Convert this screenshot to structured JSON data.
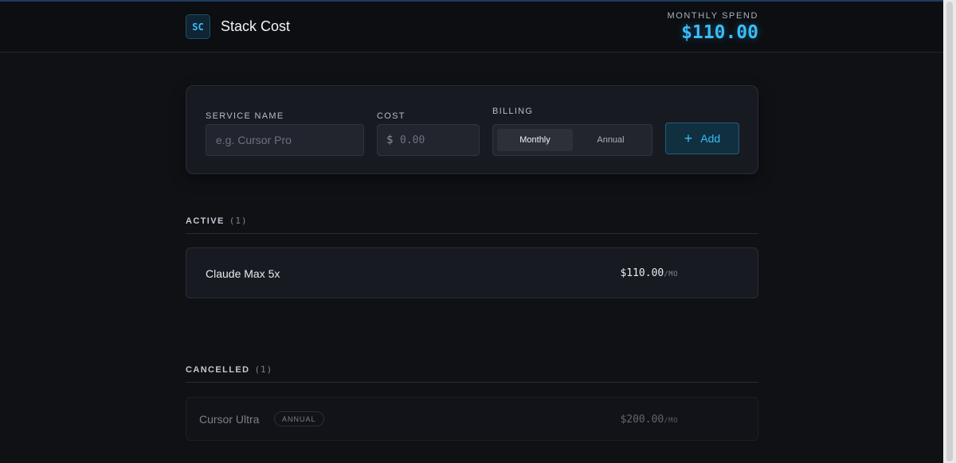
{
  "header": {
    "logo_text": "SC",
    "app_title": "Stack Cost",
    "spend_label": "MONTHLY SPEND",
    "spend_value": "$110.00"
  },
  "form": {
    "service_label": "SERVICE NAME",
    "service_placeholder": "e.g. Cursor Pro",
    "cost_label": "COST",
    "cost_prefix": "$",
    "cost_placeholder": "0.00",
    "billing_label": "BILLING",
    "billing_options": [
      "Monthly",
      "Annual"
    ],
    "billing_selected": "Monthly",
    "add_icon": "plus-icon",
    "add_label": "Add"
  },
  "active": {
    "title": "ACTIVE",
    "count": "(1)",
    "items": [
      {
        "name": "Claude Max 5x",
        "price": "$110.00",
        "per": "/MO"
      }
    ]
  },
  "cancelled": {
    "title": "CANCELLED",
    "count": "(1)",
    "items": [
      {
        "name": "Cursor Ultra",
        "badge": "ANNUAL",
        "price": "$200.00",
        "per": "/MO"
      }
    ]
  },
  "colors": {
    "accent": "#38bdf8",
    "background": "#0f1115",
    "card": "#181a21"
  }
}
